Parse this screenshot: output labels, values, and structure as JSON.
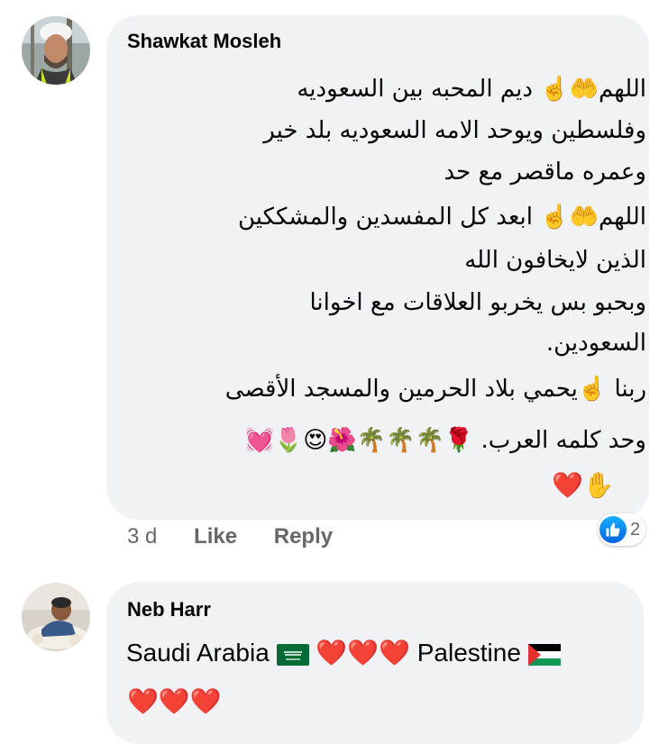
{
  "comments": [
    {
      "author": "Shawkat Mosleh",
      "lines": [
        "اللهم🤲☝️ ديم المحبه بين السعوديه",
        "وفلسطين ويوحد الامه السعوديه بلد خير",
        "وعمره ماقصر مع حد",
        "اللهم🤲☝️ ابعد كل المفسدين والمشككين",
        "الذين لايخافون الله",
        "وبحبو بس يخربو العلاقات مع اخوانا",
        "السعودين.",
        "ربنا ☝️يحمي بلاد الحرمين والمسجد الأقصى",
        "وحد كلمه العرب. 🌹🌴🌴🌴🌺😍🌷💓"
      ],
      "emoji_line": "❤️✋",
      "time": "3 d",
      "like_label": "Like",
      "reply_label": "Reply",
      "reaction_icon": "like-icon",
      "reaction_count": "2",
      "reaction_color": "#1877f2"
    },
    {
      "author": "Neb Harr",
      "line1_a": "Saudi Arabia",
      "line1_hearts": "❤️❤️❤️",
      "line1_b": "Palestine",
      "line2": "❤️❤️❤️"
    }
  ],
  "colors": {
    "bubble": "#f0f2f5",
    "meta_text": "#65676b",
    "heart": "#e0245e",
    "saudi_green": "#006c35"
  }
}
